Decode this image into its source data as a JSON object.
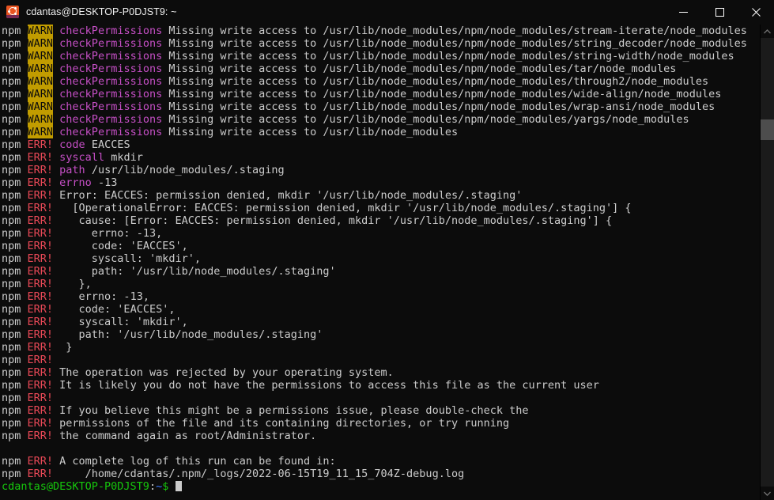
{
  "window": {
    "title": "cdantas@DESKTOP-P0DJST9: ~",
    "app_icon": "ubuntu-icon",
    "controls": {
      "minimize": "minimize-button",
      "maximize": "maximize-button",
      "close": "close-button"
    },
    "background_color": "#0C0C0C"
  },
  "colors": {
    "foreground": "#CCCCCC",
    "warn_bg": "#C19C00",
    "error": "#E74856",
    "keyword": "#C64FC6",
    "prompt_user": "#16C60C",
    "prompt_path": "#3B78FF"
  },
  "terminal": {
    "warn_label": "WARN",
    "err_label": "ERR!",
    "npm_label": "npm",
    "warn_command": "checkPermissions",
    "warn_message": "Missing write access to ",
    "warn_paths": [
      "/usr/lib/node_modules/npm/node_modules/stream-iterate/node_modules",
      "/usr/lib/node_modules/npm/node_modules/string_decoder/node_modules",
      "/usr/lib/node_modules/npm/node_modules/string-width/node_modules",
      "/usr/lib/node_modules/npm/node_modules/tar/node_modules",
      "/usr/lib/node_modules/npm/node_modules/through2/node_modules",
      "/usr/lib/node_modules/npm/node_modules/wide-align/node_modules",
      "/usr/lib/node_modules/npm/node_modules/wrap-ansi/node_modules",
      "/usr/lib/node_modules/npm/node_modules/yargs/node_modules",
      "/usr/lib/node_modules"
    ],
    "err_lines": [
      {
        "key": "code",
        "rest": " EACCES"
      },
      {
        "key": "syscall",
        "rest": " mkdir"
      },
      {
        "key": "path",
        "rest": " /usr/lib/node_modules/.staging"
      },
      {
        "key": "errno",
        "rest": " -13"
      },
      {
        "key": "",
        "rest": "Error: EACCES: permission denied, mkdir '/usr/lib/node_modules/.staging'"
      },
      {
        "key": "",
        "rest": "  [OperationalError: EACCES: permission denied, mkdir '/usr/lib/node_modules/.staging'] {"
      },
      {
        "key": "",
        "rest": "   cause: [Error: EACCES: permission denied, mkdir '/usr/lib/node_modules/.staging'] {"
      },
      {
        "key": "",
        "rest": "     errno: -13,"
      },
      {
        "key": "",
        "rest": "     code: 'EACCES',"
      },
      {
        "key": "",
        "rest": "     syscall: 'mkdir',"
      },
      {
        "key": "",
        "rest": "     path: '/usr/lib/node_modules/.staging'"
      },
      {
        "key": "",
        "rest": "   },"
      },
      {
        "key": "",
        "rest": "   errno: -13,"
      },
      {
        "key": "",
        "rest": "   code: 'EACCES',"
      },
      {
        "key": "",
        "rest": "   syscall: 'mkdir',"
      },
      {
        "key": "",
        "rest": "   path: '/usr/lib/node_modules/.staging'"
      },
      {
        "key": "",
        "rest": " }"
      },
      {
        "key": "",
        "rest": ""
      },
      {
        "key": "",
        "rest": "The operation was rejected by your operating system."
      },
      {
        "key": "",
        "rest": "It is likely you do not have the permissions to access this file as the current user"
      },
      {
        "key": "",
        "rest": ""
      },
      {
        "key": "",
        "rest": "If you believe this might be a permissions issue, please double-check the"
      },
      {
        "key": "",
        "rest": "permissions of the file and its containing directories, or try running"
      },
      {
        "key": "",
        "rest": "the command again as root/Administrator."
      }
    ],
    "blank_line": "",
    "err_tail": [
      {
        "key": "",
        "rest": "A complete log of this run can be found in:"
      },
      {
        "key": "",
        "rest": "    /home/cdantas/.npm/_logs/2022-06-15T19_11_15_704Z-debug.log"
      }
    ],
    "prompt": {
      "user_host": "cdantas@DESKTOP-P0DJST9",
      "colon": ":",
      "path": "~",
      "sigil": "$",
      "command": ""
    }
  },
  "scrollbar": {
    "up_arrow": "scroll-up-arrow",
    "down_arrow": "scroll-down-arrow",
    "thumb": "scrollbar-thumb"
  }
}
